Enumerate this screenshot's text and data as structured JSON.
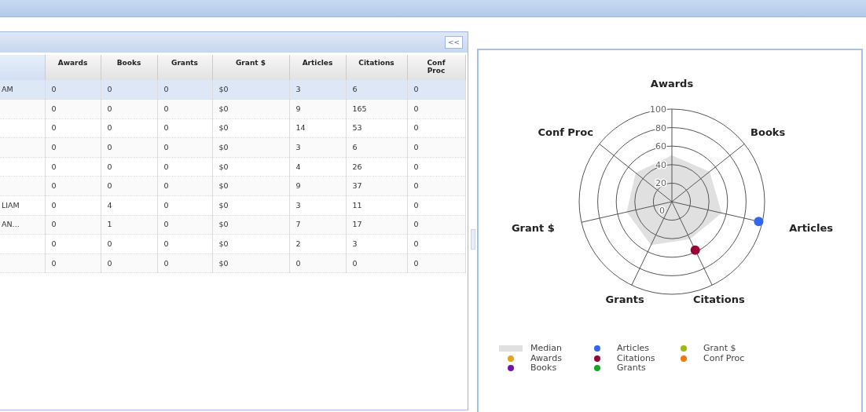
{
  "left_panel": {
    "collapse_button": "<<"
  },
  "table": {
    "columns": [
      "",
      "Awards",
      "Books",
      "Grants",
      "Grant $",
      "Articles",
      "Citations",
      "Conf Proc"
    ],
    "rows": [
      {
        "selected": true,
        "cells": [
          "AM",
          "0",
          "0",
          "0",
          "$0",
          "3",
          "6",
          "0"
        ]
      },
      {
        "selected": false,
        "cells": [
          "",
          "0",
          "0",
          "0",
          "$0",
          "9",
          "165",
          "0"
        ]
      },
      {
        "selected": false,
        "cells": [
          "",
          "0",
          "0",
          "0",
          "$0",
          "14",
          "53",
          "0"
        ]
      },
      {
        "selected": false,
        "cells": [
          "",
          "0",
          "0",
          "0",
          "$0",
          "3",
          "6",
          "0"
        ]
      },
      {
        "selected": false,
        "cells": [
          "",
          "0",
          "0",
          "0",
          "$0",
          "4",
          "26",
          "0"
        ]
      },
      {
        "selected": false,
        "cells": [
          "",
          "0",
          "0",
          "0",
          "$0",
          "9",
          "37",
          "0"
        ]
      },
      {
        "selected": false,
        "cells": [
          "LIAM",
          "0",
          "4",
          "0",
          "$0",
          "3",
          "11",
          "0"
        ]
      },
      {
        "selected": false,
        "cells": [
          "AN...",
          "0",
          "1",
          "0",
          "$0",
          "7",
          "17",
          "0"
        ]
      },
      {
        "selected": false,
        "cells": [
          "",
          "0",
          "0",
          "0",
          "$0",
          "2",
          "3",
          "0"
        ]
      },
      {
        "selected": false,
        "cells": [
          "",
          "0",
          "0",
          "0",
          "$0",
          "0",
          "0",
          "0"
        ]
      }
    ]
  },
  "radar_chart": {
    "axes": [
      "Awards",
      "Books",
      "Articles",
      "Citations",
      "Grants",
      "Grant $",
      "Conf Proc"
    ],
    "ticks": [
      "100",
      "80",
      "60",
      "40",
      "20",
      "0"
    ],
    "legend": [
      {
        "label": "Median",
        "kind": "area",
        "color": "#e0e0e0"
      },
      {
        "label": "Awards",
        "kind": "dot",
        "color": "#e8a317"
      },
      {
        "label": "Books",
        "kind": "dot",
        "color": "#7711aa"
      },
      {
        "label": "Articles",
        "kind": "dot",
        "color": "#3366ee"
      },
      {
        "label": "Citations",
        "kind": "dot",
        "color": "#990033"
      },
      {
        "label": "Grants",
        "kind": "dot",
        "color": "#11aa22"
      },
      {
        "label": "Grant $",
        "kind": "dot",
        "color": "#99bb11"
      },
      {
        "label": "Conf Proc",
        "kind": "dot",
        "color": "#ee7711"
      }
    ]
  }
}
